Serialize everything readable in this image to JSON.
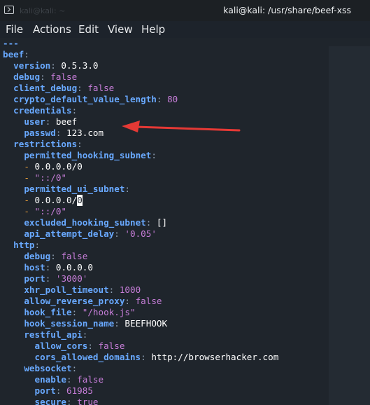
{
  "window": {
    "title": "kali@kali: /usr/share/beef-xss",
    "ghost_title": "kali@kali: ~",
    "icon": "terminal-icon"
  },
  "menu": {
    "items": [
      "File",
      "Actions",
      "Edit",
      "View",
      "Help"
    ]
  },
  "config": {
    "doc_start": "---",
    "beef_key": "beef",
    "version_key": "version",
    "version_val": "0.5.3.0",
    "debug_key": "debug",
    "debug_val": "false",
    "client_debug_key": "client_debug",
    "client_debug_val": "false",
    "crypto_key": "crypto_default_value_length",
    "crypto_val": "80",
    "credentials_key": "credentials",
    "user_key": "user",
    "user_val": "beef",
    "passwd_key": "passwd",
    "passwd_val": "123.com",
    "restrictions_key": "restrictions",
    "phs_key": "permitted_hooking_subnet",
    "phs_1": "0.0.0.0/0",
    "phs_2": "\"::/0\"",
    "pus_key": "permitted_ui_subnet",
    "pus_1a": "0.0.0.0/",
    "pus_1b": "0",
    "pus_2": "\"::/0\"",
    "ehs_key": "excluded_hooking_subnet",
    "ehs_val": "[]",
    "api_key": "api_attempt_delay",
    "api_val": "'0.05'",
    "http_key": "http",
    "h_debug_key": "debug",
    "h_debug_val": "false",
    "host_key": "host",
    "host_val": "0.0.0.0",
    "port_key": "port",
    "port_val": "'3000'",
    "xhr_key": "xhr_poll_timeout",
    "xhr_val": "1000",
    "arp_key": "allow_reverse_proxy",
    "arp_val": "false",
    "hook_file_key": "hook_file",
    "hook_file_val": "\"/hook.js\"",
    "hsn_key": "hook_session_name",
    "hsn_val": "BEEFHOOK",
    "rest_key": "restful_api",
    "cors_key": "allow_cors",
    "cors_val": "false",
    "cad_key": "cors_allowed_domains",
    "cad_val": "http://browserhacker.com",
    "ws_key": "websocket",
    "ws_enable_key": "enable",
    "ws_enable_val": "false",
    "ws_port_key": "port",
    "ws_port_val": "61985",
    "ws_secure_key": "secure",
    "ws_secure_val": "true"
  },
  "colors": {
    "key": "#69a9ff",
    "literal": "#c77ed9",
    "list_dash": "#f0a33a",
    "annotation_arrow": "#e53935"
  },
  "annotation": {
    "icon": "red-arrow-icon"
  }
}
